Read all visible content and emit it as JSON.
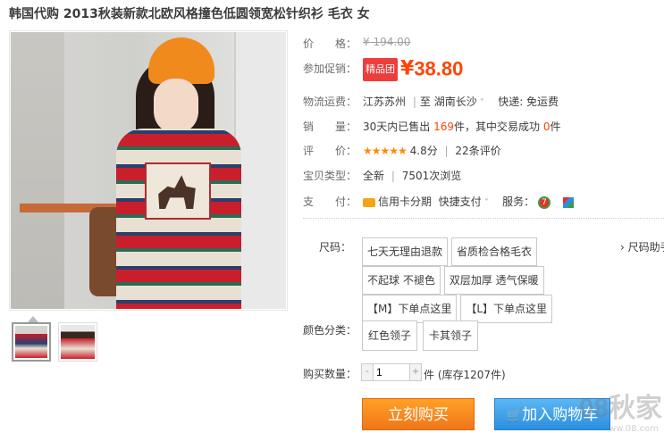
{
  "title": "韩国代购 2013秋装新款北欧风格撞色低圆领宽松针织衫 毛衣 女",
  "price": {
    "label": "价　　格：",
    "original": "¥ 194.00"
  },
  "promo": {
    "label": "参加促销：",
    "badge": "精品团",
    "yen": "¥",
    "amount": "38.80"
  },
  "shipping": {
    "label": "物流运费：",
    "from": "江苏苏州",
    "sep": "|",
    "to_prefix": "至",
    "to": "湖南长沙",
    "delivery": "快递: 免运费"
  },
  "sales": {
    "label": "销　　量：",
    "prefix": "30天内已售出",
    "count": "169",
    "mid": "件，其中交易成功",
    "success": "0",
    "suffix": "件"
  },
  "rating": {
    "label": "评　　价：",
    "stars": "★★★★★",
    "score": "4.8分",
    "reviews": "22条评价"
  },
  "type": {
    "label": "宝贝类型：",
    "cond": "全新",
    "views": "7501次浏览"
  },
  "payment": {
    "label": "支　　付：",
    "card": "信用卡分期",
    "quick": "快捷支付",
    "service_label": "服务："
  },
  "size": {
    "label": "尺码：",
    "options": [
      "七天无理由退款",
      "省质检合格毛衣",
      "不起球 不褪色",
      "双层加厚 透气保暖",
      "【M】下单点这里",
      "【L】下单点这里"
    ],
    "helper": "› 尺码助手"
  },
  "color": {
    "label": "颜色分类：",
    "options": [
      "红色领子",
      "卡其领子"
    ]
  },
  "quantity": {
    "label": "购买数量：",
    "value": "1",
    "stock": "件 (库存1207件)"
  },
  "buttons": {
    "buy": "立刻购买",
    "cart": "加入购物车"
  },
  "watermark": {
    "main": "08秋家",
    "sub": "ww.08.com"
  },
  "colors": {
    "accent": "#ff4400",
    "buy": "#f0761a",
    "cart": "#2b8fe0"
  }
}
